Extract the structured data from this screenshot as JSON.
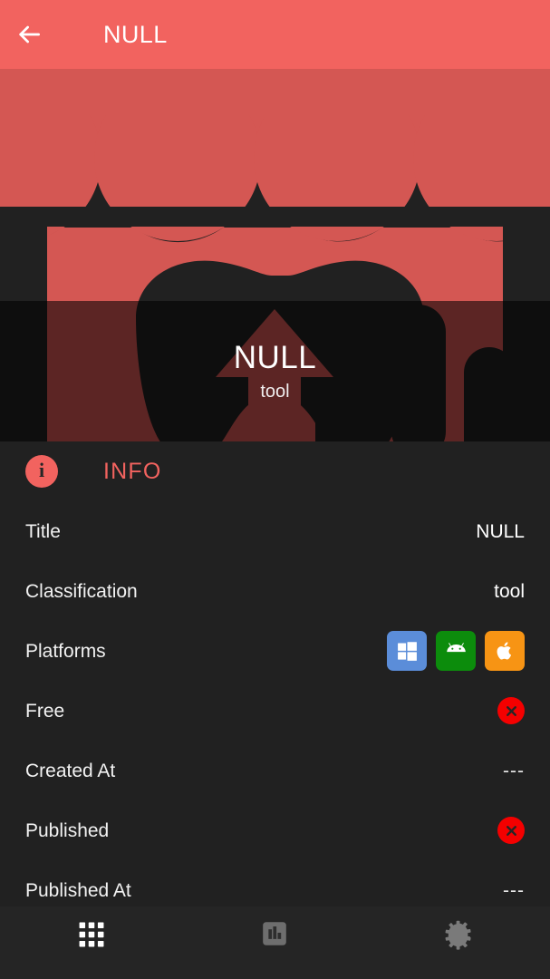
{
  "appbar": {
    "title": "NULL",
    "back_icon": "arrow-left-icon",
    "background": "#F2635F"
  },
  "hero": {
    "title": "NULL",
    "subtitle": "tool",
    "artwork_icon": "storefront-gamepad-icon",
    "background": "#F2635F",
    "art_color": "#262626"
  },
  "info_section": {
    "icon": "info-circle-icon",
    "label": "INFO",
    "accent": "#F2635F"
  },
  "rows": [
    {
      "label": "Title",
      "type": "text",
      "value": "NULL"
    },
    {
      "label": "Classification",
      "type": "text",
      "value": "tool"
    },
    {
      "label": "Platforms",
      "type": "platforms"
    },
    {
      "label": "Free",
      "type": "boolean",
      "value": false,
      "icon": "x-circle-icon"
    },
    {
      "label": "Created At",
      "type": "text",
      "value": "---"
    },
    {
      "label": "Published",
      "type": "boolean",
      "value": false,
      "icon": "x-circle-icon"
    },
    {
      "label": "Published At",
      "type": "text",
      "value": "---"
    }
  ],
  "platforms": [
    {
      "name": "Windows",
      "icon": "windows-icon",
      "color": "#5B8DD9"
    },
    {
      "name": "Android",
      "icon": "android-icon",
      "color": "#0C8C0C"
    },
    {
      "name": "Apple",
      "icon": "apple-icon",
      "color": "#F79414"
    }
  ],
  "status_colors": {
    "false_badge": "#F40000",
    "false_glyph": "#262626"
  },
  "bottom_nav": [
    {
      "name": "apps",
      "icon": "grid-apps-icon",
      "active": true
    },
    {
      "name": "stats",
      "icon": "bar-chart-icon",
      "active": false
    },
    {
      "name": "settings",
      "icon": "gear-icon",
      "active": false
    }
  ]
}
